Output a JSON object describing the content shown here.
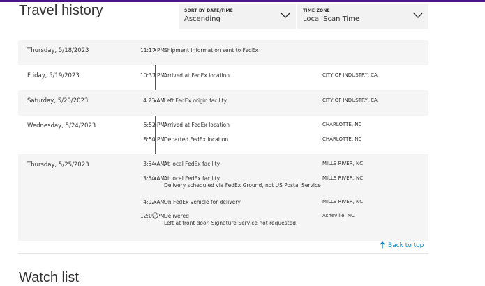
{
  "title": "Travel history",
  "sort": {
    "caption": "SORT BY DATE/TIME",
    "value": "Ascending"
  },
  "timezone": {
    "caption": "TIME ZONE",
    "value": "Local Scan Time"
  },
  "groups": [
    {
      "date": "Thursday, 5/18/2023",
      "events": [
        {
          "time": "11:17 PM",
          "desc": "Shipment information sent to FedEx",
          "loc": ""
        }
      ]
    },
    {
      "date": "Friday, 5/19/2023",
      "events": [
        {
          "time": "10:37 PM",
          "desc": "Arrived at FedEx location",
          "loc": "CITY OF INDUSTRY, CA"
        }
      ]
    },
    {
      "date": "Saturday, 5/20/2023",
      "events": [
        {
          "time": "4:23 AM",
          "desc": "Left FedEx origin facility",
          "loc": "CITY OF INDUSTRY, CA"
        }
      ]
    },
    {
      "date": "Wednesday, 5/24/2023",
      "events": [
        {
          "time": "5:52 PM",
          "desc": "Arrived at FedEx location",
          "loc": "CHARLOTTE, NC"
        },
        {
          "time": "8:50 PM",
          "desc": "Departed FedEx location",
          "loc": "CHARLOTTE, NC"
        }
      ]
    },
    {
      "date": "Thursday, 5/25/2023",
      "events": [
        {
          "time": "3:54 AM",
          "desc": "At local FedEx facility",
          "loc": "MILLS RIVER, NC"
        },
        {
          "time": "3:54 AM",
          "desc": "At local FedEx facility",
          "desc2": "Delivery scheduled via FedEx Ground, not US Postal Service",
          "loc": "MILLS RIVER, NC"
        },
        {
          "time": "4:02 AM",
          "desc": "On FedEx vehicle for delivery",
          "loc": "MILLS RIVER, NC"
        },
        {
          "time": "12:01 PM",
          "desc": "Delivered",
          "desc2": "Left at front door. Signature Service not requested.",
          "loc": "Asheville, NC"
        }
      ]
    }
  ],
  "back_to_top": "Back to top",
  "next_section_title": "Watch list",
  "colors": {
    "brand_purple": "#4d148c",
    "link_blue": "#007ab7",
    "shaded_row": "#f5f5f5"
  },
  "icons": {
    "select_chevron": "chevron-down-icon",
    "delivered": "check-circle-icon",
    "back_to_top": "arrow-up-icon"
  }
}
